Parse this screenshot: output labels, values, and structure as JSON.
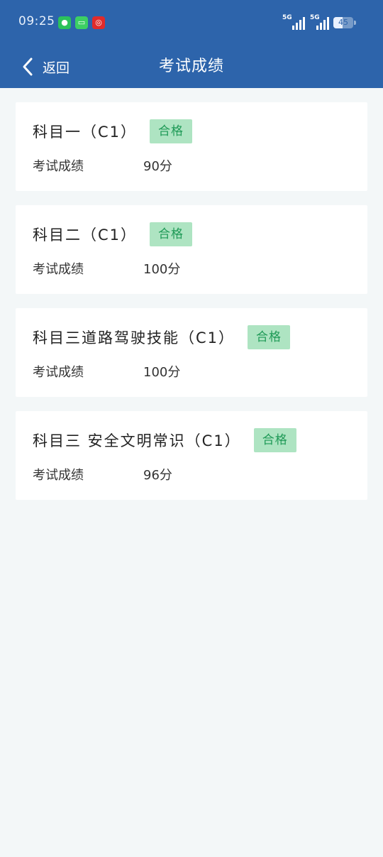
{
  "status_bar": {
    "time": "09:25",
    "network_1": "5G",
    "network_2": "5G",
    "battery": "45",
    "battery_level_percent": 45,
    "apps": [
      "wechat-icon",
      "messages-icon",
      "netease-music-icon"
    ]
  },
  "nav": {
    "back_label": "返回",
    "title": "考试成绩"
  },
  "colors": {
    "header": "#2d64ab",
    "page_bg": "#f3f7f8",
    "badge_bg": "#aee4c2",
    "badge_text": "#1f9a57"
  },
  "results": [
    {
      "subject": "科目一（C1）",
      "status": "合格",
      "score_label": "考试成绩",
      "score": "90分"
    },
    {
      "subject": "科目二（C1）",
      "status": "合格",
      "score_label": "考试成绩",
      "score": "100分"
    },
    {
      "subject": "科目三道路驾驶技能（C1）",
      "status": "合格",
      "score_label": "考试成绩",
      "score": "100分"
    },
    {
      "subject": "科目三 安全文明常识（C1）",
      "status": "合格",
      "score_label": "考试成绩",
      "score": "96分"
    }
  ]
}
